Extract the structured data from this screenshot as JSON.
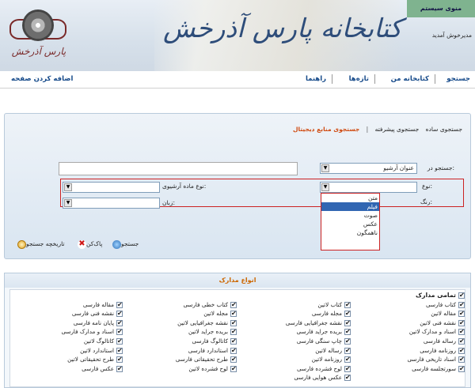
{
  "header": {
    "system_menu": "منوی سیستم",
    "welcome": "مدیرخوش آمدید",
    "banner": "کتابخانه پارس آذرخش",
    "logo_text": "پارس آذرخش"
  },
  "nav": {
    "search": "جستجو",
    "my_library": "کتابخانه من",
    "new": "تازه‌ها",
    "help": "راهنما",
    "add_page": "اضافه کردن صفحه"
  },
  "search": {
    "tabs": {
      "simple": "جستجوی ساده",
      "advanced": "جستجوی پیشرفته",
      "separator": "|",
      "digital": "جستجوی منابع دیجیتال"
    },
    "search_in_label": "جستجو در:",
    "search_in_value": "عنوان آرشیو",
    "search_text": "",
    "type_label": "نوع:",
    "type_value": "",
    "archive_type_label": "نوع ماده آرشیوی:",
    "archive_type_value": "",
    "color_label": "رنگ:",
    "language_label": "زبان:",
    "language_value": "",
    "type_options": [
      "متن",
      "فیلم",
      "صوت",
      "عکس",
      "ناهمگون"
    ],
    "type_selected": "فیلم",
    "buttons": {
      "search": "جستجو",
      "clear": "پاک‌کن",
      "history": "تاریخچه جستجو"
    }
  },
  "doc_types": {
    "title": "انواع مدارک",
    "all_label": "تمامی مدارک",
    "columns": [
      [
        "کتاب فارسی",
        "مقاله لاتین",
        "نقشه فنی لاتین",
        "اسناد و مدارک لاتین",
        "رساله فارسی",
        "روزنامه فارسی",
        "اسناد تاریخی فارسی",
        "سورتجلسه فارسی"
      ],
      [
        "کتاب لاتین",
        "مجله فارسی",
        "نقشه جغرافیایی فارسی",
        "بریده جراید فارسی",
        "چاپ سنگی فارسی",
        "رساله لاتین",
        "روزنامه لاتین",
        "لوح فشرده فارسی",
        "عکس هوایی فارسی"
      ],
      [
        "کتاب خطی فارسی",
        "مجله لاتین",
        "نقشه جغرافیایی لاتین",
        "بریده جراید لاتین",
        "کاتالوگ فارسی",
        "استاندارد فارسی",
        "طرح تحقیقاتی فارسی",
        "لوح فشرده لاتین"
      ],
      [
        "مقاله فارسی",
        "نقشه فنی فارسی",
        "پایان نامه فارسی",
        "اسناد و مدارک فارسی",
        "کاتالوگ لاتین",
        "استاندارد لاتین",
        "طرح تحقیقاتی لاتین",
        "عکس فارسی"
      ]
    ]
  }
}
